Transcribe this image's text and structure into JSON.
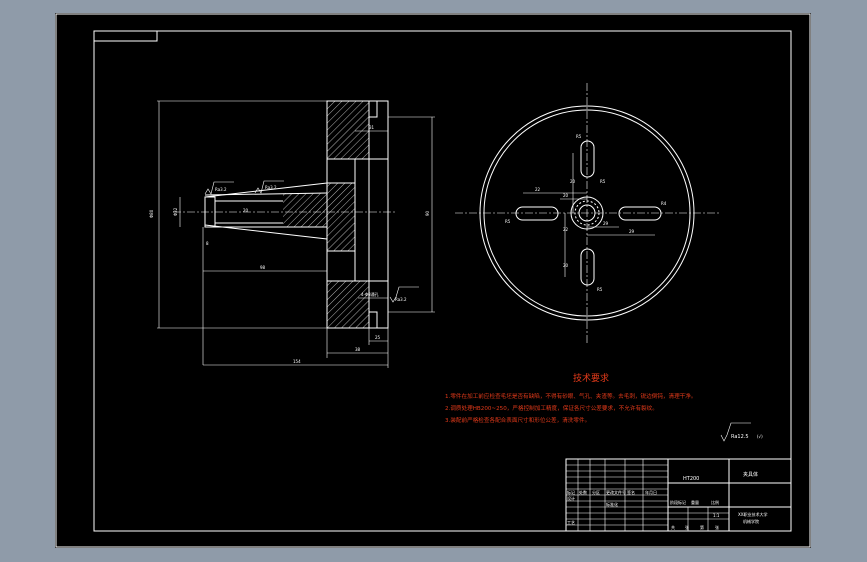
{
  "dims": {
    "d_left_height": "Φ80",
    "d_small": "Φ32",
    "len_98": "98",
    "len_154": "154",
    "len_38": "38",
    "len_25": "25",
    "len_31": "31",
    "len_90": "90",
    "len_20": "20",
    "len_8": "8",
    "rough_a": "Ra3.2",
    "rough_b": "Ra3.2",
    "rough_c": "Ra3.2",
    "rough_d": "Ra3.2",
    "hole_note": "4-Φ8通孔"
  },
  "front_view": {
    "r_tl": "R5",
    "r_tr": "R5",
    "r_l": "R5",
    "r_r": "R4",
    "r_b": "R5",
    "d_22": "22",
    "d_20a": "20",
    "d_20b": "20",
    "d_29a": "29",
    "d_29b": "29",
    "d_20c": "20",
    "d_22b": "22"
  },
  "tech": {
    "title": "技术要求",
    "line1": "1.零件在加工前应检查毛坯是否有缺陷，不得有砂眼、气孔、夹渣等。去毛刺，锐边倒钝，清理干净。",
    "line2": "2.调质处理HB200~250，严格控制加工精度，保证各尺寸公差要求，不允许有裂纹。",
    "line3": "3.装配前严格检查各配合表面尺寸和形位公差，清洗零件。"
  },
  "roughness_general": "Ra12.5",
  "roughness_general_suffix": "(√)",
  "title_block": {
    "material": "HT200",
    "part_name": "夹具体",
    "h_mark": "标记",
    "h_count": "处数",
    "h_zone": "分区",
    "h_docno": "更改文件号",
    "h_sign": "签名",
    "h_date": "年月日",
    "r_design": "设计",
    "r_std": "标准化",
    "r_process": "工艺",
    "stage": "阶段标记",
    "weight": "重量",
    "scale": "比例",
    "scale_val": "1:1",
    "sheet_total": "共",
    "sheet_num": "张",
    "sheet_of": "第",
    "sheet_of2": "张",
    "school": "XX职业技术大学",
    "company": "机械学院"
  }
}
